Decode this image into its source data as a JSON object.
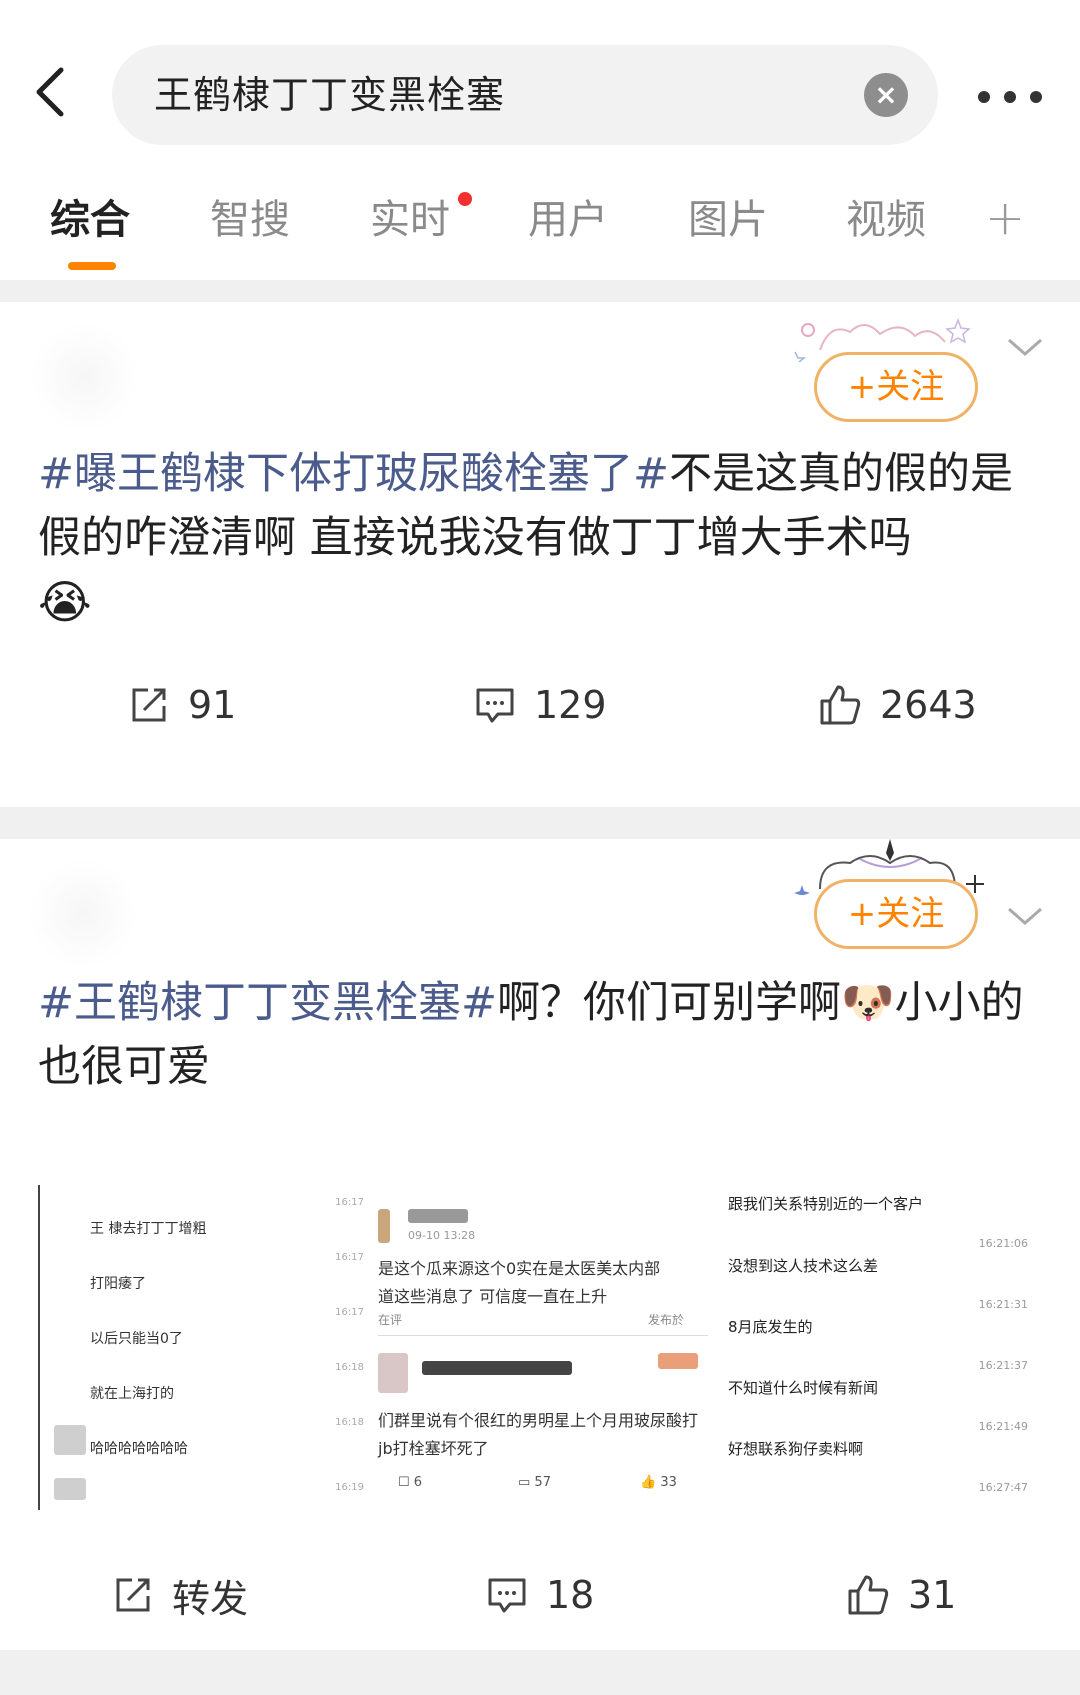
{
  "search": {
    "query": "王鹤棣丁丁变黑栓塞"
  },
  "tabs": [
    {
      "label": "综合",
      "active": true
    },
    {
      "label": "智搜",
      "active": false
    },
    {
      "label": "实时",
      "active": false,
      "dot": true
    },
    {
      "label": "用户",
      "active": false
    },
    {
      "label": "图片",
      "active": false
    },
    {
      "label": "视频",
      "active": false
    }
  ],
  "tab_plus": "+",
  "colors": {
    "accent": "#ff8200",
    "hashtag": "#4a5b8c",
    "dot": "#f23030"
  },
  "post1": {
    "follow_label": "+关注",
    "hashtag": "#曝王鹤棣下体打玻尿酸栓塞了#",
    "text": "不是这真的假的是假的咋澄清啊 直接说我没有做丁丁增大手术吗",
    "emoji": "😭",
    "reposts": "91",
    "comments": "129",
    "likes": "2643"
  },
  "post2": {
    "follow_label": "+关注",
    "hashtag": "#王鹤棣丁丁变黑栓塞#",
    "text_a": "啊？你们可别学啊",
    "emoji": "🐶",
    "text_b": "小小的也很可爱",
    "repost_label": "转发",
    "comments": "18",
    "likes": "31",
    "image": {
      "col1": {
        "lines": [
          "王 棣去打丁丁增粗",
          "打阳痿了",
          "以后只能当0了",
          "就在上海打的",
          "哈哈哈哈哈哈哈"
        ],
        "times": [
          "16:17",
          "16:17",
          "16:17",
          "16:18",
          "16:18",
          "16:19"
        ]
      },
      "col2": {
        "date": "09-10 13:28",
        "text1": "是这个瓜来源这个0实在是太医美太内部",
        "text2": "道这些消息了 可信度一直在上升",
        "footer1": "在评",
        "footer2": "发布於",
        "text3": "们群里说有个很红的男明星上个月用玻尿酸打",
        "text4": "jb打栓塞坏死了",
        "reposts": "6",
        "comments": "57",
        "likes": "33"
      },
      "col3": {
        "lines": [
          "跟我们关系特别近的一个客户",
          "没想到这人技术这么差",
          "8月底发生的",
          "不知道什么时候有新闻",
          "好想联系狗仔卖料啊"
        ],
        "times": [
          "16:21:06",
          "16:21:31",
          "16:21:37",
          "16:21:49",
          "16:27:47"
        ]
      }
    }
  }
}
